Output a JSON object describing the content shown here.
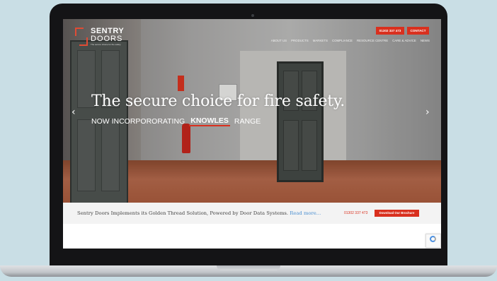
{
  "header": {
    "logo_sentry": "SENTRY",
    "logo_doors": "DOORS",
    "logo_tagline": "The secure choice for fire safety",
    "phone_button": "01302 337 473",
    "contact_button": "CONTACT"
  },
  "nav": {
    "items": [
      "ABOUT US",
      "PRODUCTS",
      "MARKETS",
      "COMPLIANCE",
      "RESOURCE CENTRE",
      "CARE & ADVICE",
      "NEWS"
    ]
  },
  "hero": {
    "headline": "The secure choice for fire safety.",
    "sub_before": "NOW INCORPORORATING",
    "sub_highlight": "KNOWLES",
    "sub_after": "RANGE",
    "prev_arrow": "‹",
    "next_arrow": "›"
  },
  "banner": {
    "text": "Sentry Doors Implements its Golden Thread Solution, Powered by Door Data Systems.",
    "link": "Read more...",
    "phone": "01302 337 473",
    "download_button": "Download Our Brochure"
  },
  "colors": {
    "accent": "#d9301e",
    "link": "#4a8fd1",
    "background": "#c9dee5"
  }
}
